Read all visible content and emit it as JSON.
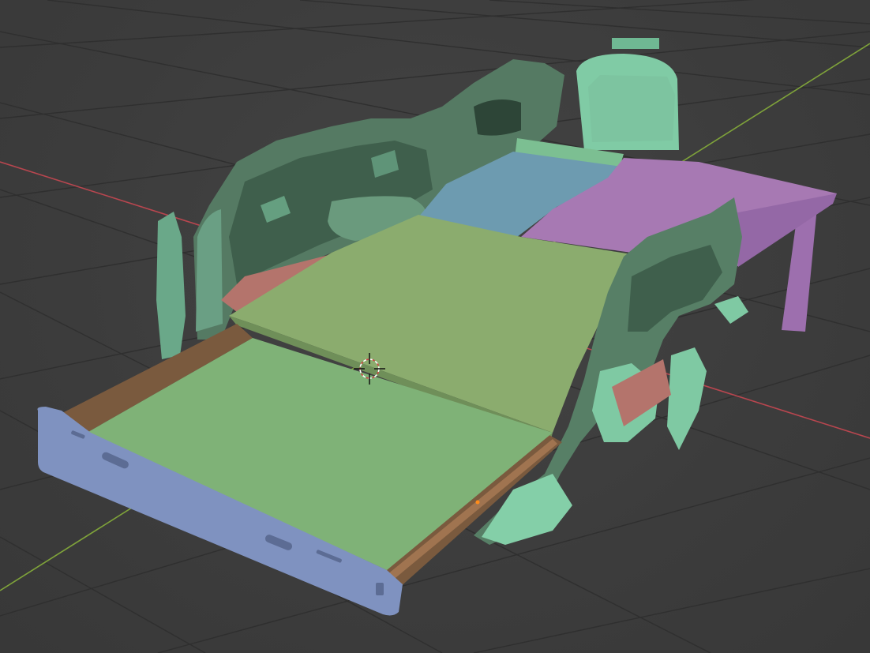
{
  "viewport": {
    "background": "#3d3d3d",
    "grid_color": "#303030",
    "x_axis_color": "#b8464f",
    "y_axis_color": "#7fa33a"
  },
  "scene": {
    "scan_mesh_color": "#7fc9a3",
    "drawer_lid_color": "#7fb277",
    "upper_deck_color": "#8bac6e",
    "rear_panel_blue_color": "#6d9bb0",
    "rear_panel_purple_color": "#a779b3",
    "front_face_color": "#7f92c0",
    "side_rail_color": "#7a5a3e",
    "side_panel_red_color": "#b4746c"
  },
  "overlays": {
    "cursor_icon": "3d-cursor-icon",
    "origin_icon": "object-origin-icon"
  }
}
